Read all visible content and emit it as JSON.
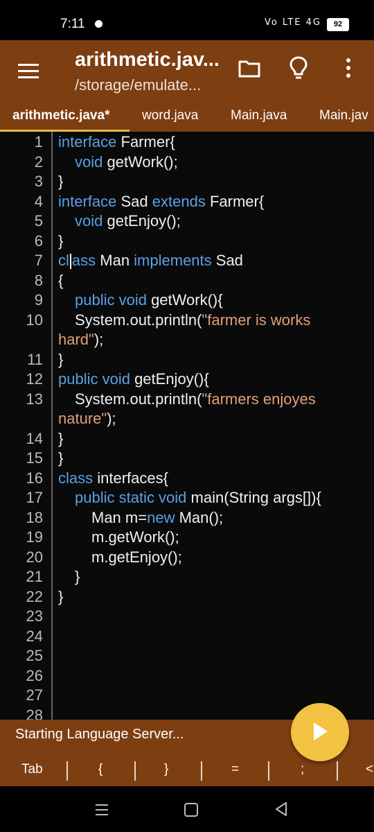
{
  "status_bar": {
    "time": "7:11",
    "network": "Vo LTE 4G",
    "battery": "92"
  },
  "app_bar": {
    "title": "arithmetic.jav...",
    "subtitle": "/storage/emulate..."
  },
  "tabs": [
    {
      "label": "arithmetic.java*",
      "active": true
    },
    {
      "label": "word.java",
      "active": false
    },
    {
      "label": "Main.java",
      "active": false
    },
    {
      "label": "Main.jav",
      "active": false
    }
  ],
  "editor": {
    "line_numbers": [
      "1",
      "2",
      "3",
      "4",
      "5",
      "6",
      "7",
      "8",
      "9",
      "10",
      "11",
      "12",
      "13",
      "14",
      "15",
      "16",
      "17",
      "18",
      "19",
      "20",
      "21",
      "22",
      "23",
      "24",
      "25",
      "26",
      "27",
      "28"
    ],
    "lines": [
      {
        "indent": 0,
        "parts": [
          [
            "kw",
            "interface"
          ],
          [
            "t",
            " Farmer{"
          ]
        ]
      },
      {
        "indent": 1,
        "parts": [
          [
            "kw",
            "void"
          ],
          [
            "t",
            " getWork();"
          ]
        ]
      },
      {
        "indent": 0,
        "parts": [
          [
            "t",
            "}"
          ]
        ]
      },
      {
        "indent": 0,
        "parts": [
          [
            "kw",
            "interface"
          ],
          [
            "t",
            " Sad "
          ],
          [
            "kw",
            "extends"
          ],
          [
            "t",
            " Farmer{"
          ]
        ]
      },
      {
        "indent": 1,
        "parts": [
          [
            "kw",
            "void"
          ],
          [
            "t",
            " getEnjoy();"
          ]
        ]
      },
      {
        "indent": 0,
        "parts": [
          [
            "t",
            "}"
          ]
        ]
      },
      {
        "indent": 0,
        "parts": [
          [
            "kw",
            "cl"
          ],
          [
            "caret",
            ""
          ],
          [
            "kw",
            "ass"
          ],
          [
            "t",
            " Man "
          ],
          [
            "kw",
            "implements"
          ],
          [
            "t",
            " Sad"
          ]
        ]
      },
      {
        "indent": 0,
        "parts": [
          [
            "t",
            "{"
          ]
        ]
      },
      {
        "indent": 1,
        "parts": [
          [
            "kw",
            "public void"
          ],
          [
            "t",
            " getWork(){"
          ]
        ]
      },
      {
        "indent": 1,
        "parts": [
          [
            "t",
            "System.out.println("
          ],
          [
            "str",
            "\"farmer is works"
          ]
        ]
      },
      {
        "indent": 0,
        "parts": [
          [
            "str",
            "hard\""
          ],
          [
            "t",
            ");"
          ]
        ]
      },
      {
        "indent": 0,
        "parts": [
          [
            "t",
            "}"
          ]
        ]
      },
      {
        "indent": 0,
        "parts": [
          [
            "kw",
            "public void"
          ],
          [
            "t",
            " getEnjoy(){"
          ]
        ]
      },
      {
        "indent": 1,
        "parts": [
          [
            "t",
            "System.out.println("
          ],
          [
            "str",
            "\"farmers enjoyes"
          ]
        ]
      },
      {
        "indent": 0,
        "parts": [
          [
            "str",
            "nature\""
          ],
          [
            "t",
            ");"
          ]
        ]
      },
      {
        "indent": 0,
        "parts": [
          [
            "t",
            "}"
          ]
        ]
      },
      {
        "indent": 0,
        "parts": [
          [
            "t",
            "}"
          ]
        ]
      },
      {
        "indent": 0,
        "parts": [
          [
            "kw",
            "class"
          ],
          [
            "t",
            " interfaces{"
          ]
        ]
      },
      {
        "indent": 1,
        "parts": [
          [
            "kw",
            "public static void"
          ],
          [
            "t",
            " main(String args[]){"
          ]
        ]
      },
      {
        "indent": 2,
        "parts": [
          [
            "t",
            "Man m="
          ],
          [
            "kw",
            "new"
          ],
          [
            "t",
            " Man();"
          ]
        ]
      },
      {
        "indent": 2,
        "parts": [
          [
            "t",
            "m.getWork();"
          ]
        ]
      },
      {
        "indent": 2,
        "parts": [
          [
            "t",
            "m.getEnjoy();"
          ]
        ]
      },
      {
        "indent": 1,
        "parts": [
          [
            "t",
            "}"
          ]
        ]
      },
      {
        "indent": 0,
        "parts": [
          [
            "t",
            "}"
          ]
        ]
      }
    ],
    "line_number_rows": [
      0,
      1,
      2,
      3,
      4,
      5,
      6,
      7,
      8,
      9,
      11,
      12,
      13,
      15,
      16,
      17,
      18,
      19,
      20,
      21,
      22,
      23,
      24,
      25,
      26,
      27,
      28,
      29
    ]
  },
  "bottom_bar": {
    "status_message": "Starting Language Server...",
    "symbols": [
      "Tab",
      "{",
      "}",
      "=",
      ";",
      "<"
    ]
  },
  "colors": {
    "app_bar": "#7d3e12",
    "keyword": "#5aa0e6",
    "string": "#e2a07a",
    "fab": "#f2c242",
    "tab_indicator": "#e0b94a"
  }
}
